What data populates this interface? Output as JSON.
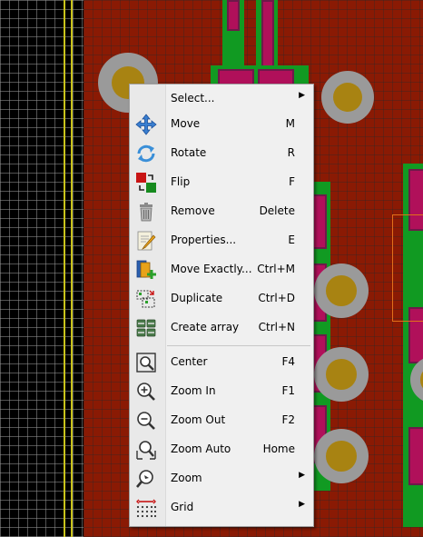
{
  "menu": {
    "items": [
      {
        "label": "Select...",
        "shortcut": "",
        "submenu": true,
        "icon": "none"
      },
      {
        "label": "Move",
        "shortcut": "M",
        "submenu": false,
        "icon": "move-icon"
      },
      {
        "label": "Rotate",
        "shortcut": "R",
        "submenu": false,
        "icon": "rotate-icon"
      },
      {
        "label": "Flip",
        "shortcut": "F",
        "submenu": false,
        "icon": "flip-icon"
      },
      {
        "label": "Remove",
        "shortcut": "Delete",
        "submenu": false,
        "icon": "trash-icon"
      },
      {
        "label": "Properties...",
        "shortcut": "E",
        "submenu": false,
        "icon": "properties-icon"
      },
      {
        "label": "Move Exactly...",
        "shortcut": "Ctrl+M",
        "submenu": false,
        "icon": "move-exactly-icon"
      },
      {
        "label": "Duplicate",
        "shortcut": "Ctrl+D",
        "submenu": false,
        "icon": "duplicate-icon"
      },
      {
        "label": "Create array",
        "shortcut": "Ctrl+N",
        "submenu": false,
        "icon": "array-icon"
      },
      {
        "label": "Center",
        "shortcut": "F4",
        "submenu": false,
        "icon": "center-icon"
      },
      {
        "label": "Zoom In",
        "shortcut": "F1",
        "submenu": false,
        "icon": "zoom-in-icon"
      },
      {
        "label": "Zoom Out",
        "shortcut": "F2",
        "submenu": false,
        "icon": "zoom-out-icon"
      },
      {
        "label": "Zoom Auto",
        "shortcut": "Home",
        "submenu": false,
        "icon": "zoom-auto-icon"
      },
      {
        "label": "Zoom",
        "shortcut": "",
        "submenu": true,
        "icon": "zoom-icon"
      },
      {
        "label": "Grid",
        "shortcut": "",
        "submenu": true,
        "icon": "grid-icon"
      }
    ],
    "submenu_arrow": "▶"
  },
  "colors": {
    "board": "#8a1a04",
    "copper_green": "#119a22",
    "pad_magenta": "#b0105a",
    "via_gray": "#9a9a9a",
    "via_gold": "#a88312",
    "edge_yellow": "#c9c31b"
  }
}
